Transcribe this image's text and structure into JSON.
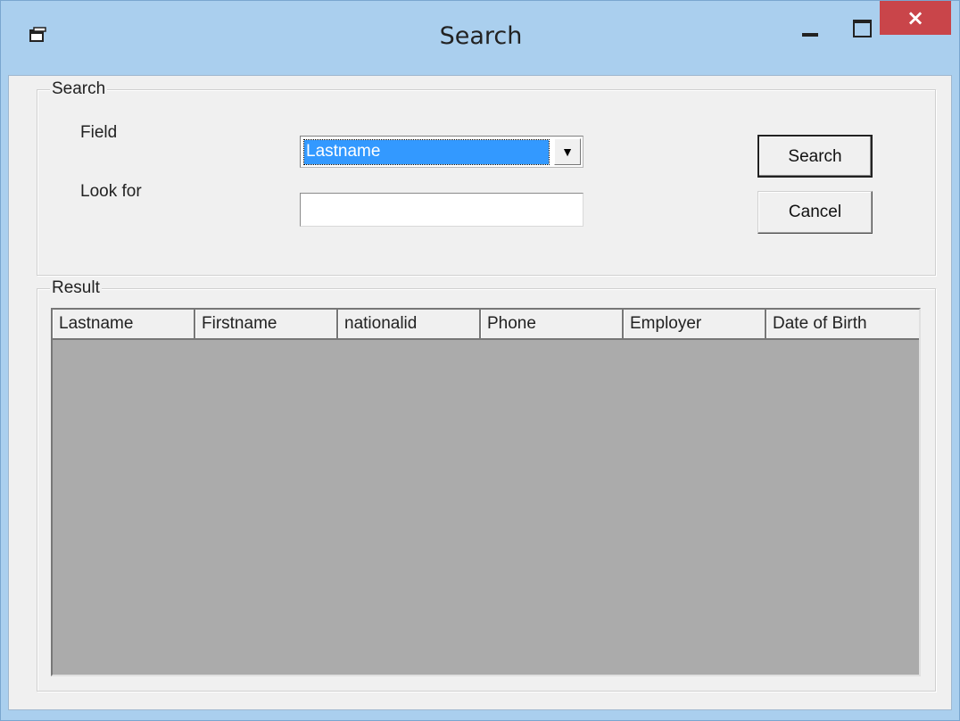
{
  "window": {
    "title": "Search",
    "icon": "window-app-icon",
    "close_label": "×"
  },
  "search_group": {
    "caption": "Search",
    "field_label": "Field",
    "field_selected": "Lastname",
    "lookfor_label": "Look for",
    "lookfor_value": "",
    "search_button": "Search",
    "cancel_button": "Cancel"
  },
  "result_group": {
    "caption": "Result",
    "columns": [
      "Lastname",
      "Firstname",
      "nationalid",
      "Phone",
      "Employer",
      "Date of Birth"
    ],
    "rows": []
  },
  "colors": {
    "titlebar": "#aacfee",
    "close_button": "#c9454a",
    "selection": "#3399ff",
    "grid_empty": "#ababab"
  }
}
